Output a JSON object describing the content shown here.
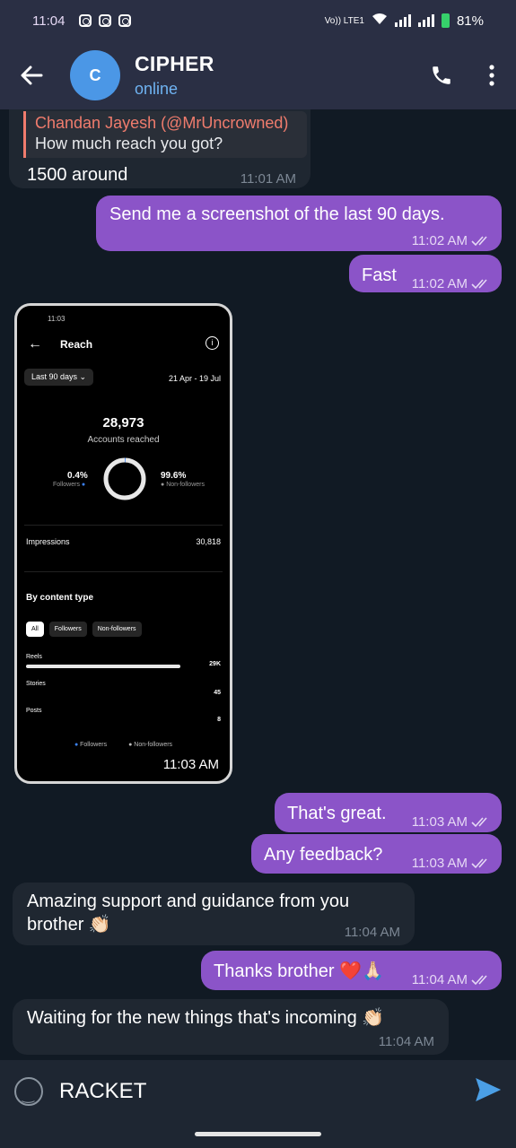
{
  "status_bar": {
    "time": "11:04",
    "battery": "81%",
    "network_label": "Vo)) LTE1"
  },
  "header": {
    "avatar_letter": "C",
    "title": "CIPHER",
    "subtitle": "online",
    "icons": [
      "back-arrow-icon",
      "phone-icon",
      "more-vert-icon"
    ]
  },
  "messages": [
    {
      "id": "m1",
      "direction": "incoming",
      "quote_author": "Chandan Jayesh (@MrUncrowned)",
      "quote_text": "How much reach you got?",
      "text": "1500 around",
      "time": "11:01 AM"
    },
    {
      "id": "m2",
      "direction": "outgoing",
      "text": "Send me a screenshot of the last 90 days.",
      "time": "11:02 AM"
    },
    {
      "id": "m3",
      "direction": "outgoing",
      "text": "Fast",
      "time": "11:02 AM"
    },
    {
      "id": "m4",
      "direction": "incoming",
      "type": "image",
      "time": "11:03 AM"
    },
    {
      "id": "m5",
      "direction": "outgoing",
      "text": "That's great.",
      "time": "11:03 AM"
    },
    {
      "id": "m6",
      "direction": "outgoing",
      "text": "Any feedback?",
      "time": "11:03 AM"
    },
    {
      "id": "m7",
      "direction": "incoming",
      "text": "Amazing support and guidance from you brother 👏🏻",
      "time": "11:04 AM"
    },
    {
      "id": "m8",
      "direction": "outgoing",
      "text": "Thanks brother ❤️🙏🏻",
      "time": "11:04 AM"
    },
    {
      "id": "m9",
      "direction": "incoming",
      "text": "Waiting for the new things that's incoming 👏🏻",
      "time": "11:04 AM"
    }
  ],
  "screenshot": {
    "status_time": "11:03",
    "title": "Reach",
    "range_button": "Last 90 days",
    "date_range": "21 Apr - 19 Jul",
    "accounts_reached_value": "28,973",
    "accounts_reached_label": "Accounts reached",
    "followers_pct": "0.4%",
    "followers_label": "Followers",
    "non_followers_pct": "99.6%",
    "non_followers_label": "Non-followers",
    "impressions_label": "Impressions",
    "impressions_value": "30,818",
    "by_content_type": "By content type",
    "chips": [
      "All",
      "Followers",
      "Non-followers"
    ],
    "rows": [
      {
        "label": "Reels",
        "value": "29K",
        "fraction": 1.0
      },
      {
        "label": "Stories",
        "value": "45",
        "fraction": 0.0
      },
      {
        "label": "Posts",
        "value": "8",
        "fraction": 0.0
      }
    ],
    "legend": [
      "Followers",
      "Non-followers"
    ],
    "donut_followers_fraction": 0.004,
    "colors": {
      "followers": "#3b82f6",
      "non_followers": "#e8e8e8"
    }
  },
  "input": {
    "text": "RACKET"
  },
  "colors": {
    "outgoing_bubble": "#8b54c8",
    "incoming_bubble": "#1f2731",
    "header": "#2a2f44",
    "online": "#6fb3f2",
    "quote_accent": "#f07c6d",
    "send": "#4b9fe6"
  }
}
